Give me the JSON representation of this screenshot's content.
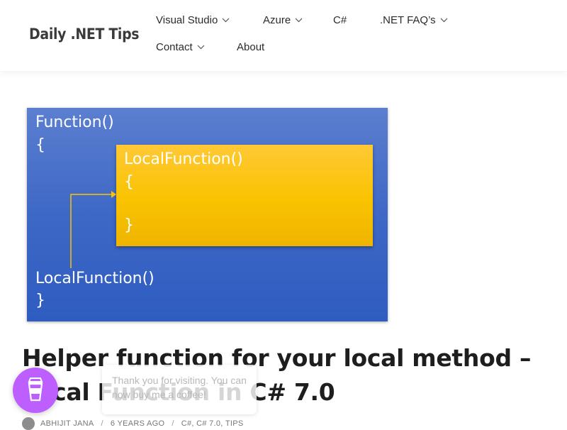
{
  "header": {
    "logo": "Daily .NET Tips",
    "nav": [
      {
        "label": "Visual Studio",
        "has_dropdown": true
      },
      {
        "label": "Azure",
        "has_dropdown": true
      },
      {
        "label": "C#",
        "has_dropdown": false
      },
      {
        "label": ".NET FAQ’s",
        "has_dropdown": true
      },
      {
        "label": "Contact",
        "has_dropdown": true
      },
      {
        "label": "About",
        "has_dropdown": false
      }
    ]
  },
  "banner": {
    "outer_open": "Function()",
    "outer_brace_open": "{",
    "inner_open": "LocalFunction()",
    "inner_brace_open": "{",
    "inner_brace_close": "}",
    "call": "LocalFunction()",
    "outer_brace_close": "}",
    "colors": {
      "outer": "#3e68c6",
      "inner": "#f9c300",
      "arrow": "#f9c300"
    }
  },
  "post": {
    "title": "Helper function for your local method – Local Function in C# 7.0",
    "meta": {
      "author": "ABHIJIT JANA",
      "date": "6 YEARS AGO",
      "categories": "C#, C# 7.0, TIPS"
    }
  },
  "coffee_widget": {
    "icon": "coffee-cup-icon",
    "message": "Thank you for visiting. You can now buy me a coffee!",
    "color": "#bd5fff"
  }
}
